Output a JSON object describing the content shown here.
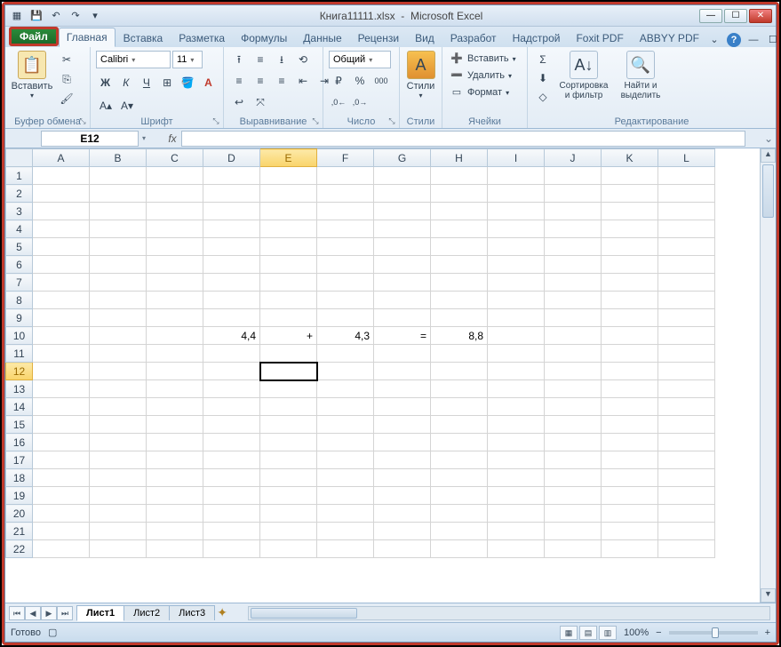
{
  "title": {
    "filename": "Книга11111.xlsx",
    "app": "Microsoft Excel"
  },
  "qat": {
    "save": "💾",
    "undo": "↶",
    "redo": "↷",
    "more": "▾"
  },
  "winbtns": {
    "min": "—",
    "max": "☐",
    "close": "✕"
  },
  "tabs": {
    "file": "Файл",
    "home": "Главная",
    "insert": "Вставка",
    "layout": "Разметка",
    "formulas": "Формулы",
    "data": "Данные",
    "review": "Рецензи",
    "view": "Вид",
    "dev": "Разработ",
    "addins": "Надстрой",
    "foxit": "Foxit PDF",
    "abbyy": "ABBYY PDF"
  },
  "help": {
    "style": "⌄",
    "q": "?",
    "min": "—",
    "max": "☐",
    "close": "✕"
  },
  "ribbon": {
    "clipboard": {
      "label": "Буфер обмена",
      "paste": "Вставить",
      "cut": "✂",
      "copy": "⎘",
      "painter": "🖌"
    },
    "font": {
      "label": "Шрифт",
      "name": "Calibri",
      "size": "11",
      "bold": "Ж",
      "italic": "К",
      "underline": "Ч",
      "border": "⊞",
      "fill": "🪣",
      "color": "A",
      "grow": "A▴",
      "shrink": "A▾"
    },
    "align": {
      "label": "Выравнивание",
      "top": "⭱",
      "mid": "≡",
      "bot": "⭳",
      "left": "≡",
      "center": "≡",
      "right": "≡",
      "wrap": "↩",
      "merge": "⤧",
      "orient": "⟲",
      "indentL": "⇤",
      "indentR": "⇥"
    },
    "number": {
      "label": "Число",
      "format": "Общий",
      "currency": "₽",
      "percent": "%",
      "comma": "000",
      "inc": ",0←",
      "dec": ",0→"
    },
    "styles": {
      "label": "Стили",
      "btn": "Стили"
    },
    "cells": {
      "label": "Ячейки",
      "insert": "Вставить",
      "delete": "Удалить",
      "format": "Формат"
    },
    "editing": {
      "label": "Редактирование",
      "sum": "Σ",
      "fill": "⬇",
      "clear": "◇",
      "sort": "Сортировка и фильтр",
      "find": "Найти и выделить"
    }
  },
  "namebox": "E12",
  "columns": [
    "A",
    "B",
    "C",
    "D",
    "E",
    "F",
    "G",
    "H",
    "I",
    "J",
    "K",
    "L"
  ],
  "rows": [
    "1",
    "2",
    "3",
    "4",
    "5",
    "6",
    "7",
    "8",
    "9",
    "10",
    "11",
    "12",
    "13",
    "14",
    "15",
    "16",
    "17",
    "18",
    "19",
    "20",
    "21",
    "22"
  ],
  "active": {
    "row": 12,
    "col": "E"
  },
  "cells": {
    "D10": "4,4",
    "E10": "+",
    "F10": "4,3",
    "G10": "=",
    "H10": "8,8"
  },
  "sheets": {
    "s1": "Лист1",
    "s2": "Лист2",
    "s3": "Лист3"
  },
  "status": {
    "ready": "Готово",
    "zoom": "100%",
    "minus": "−",
    "plus": "+"
  }
}
